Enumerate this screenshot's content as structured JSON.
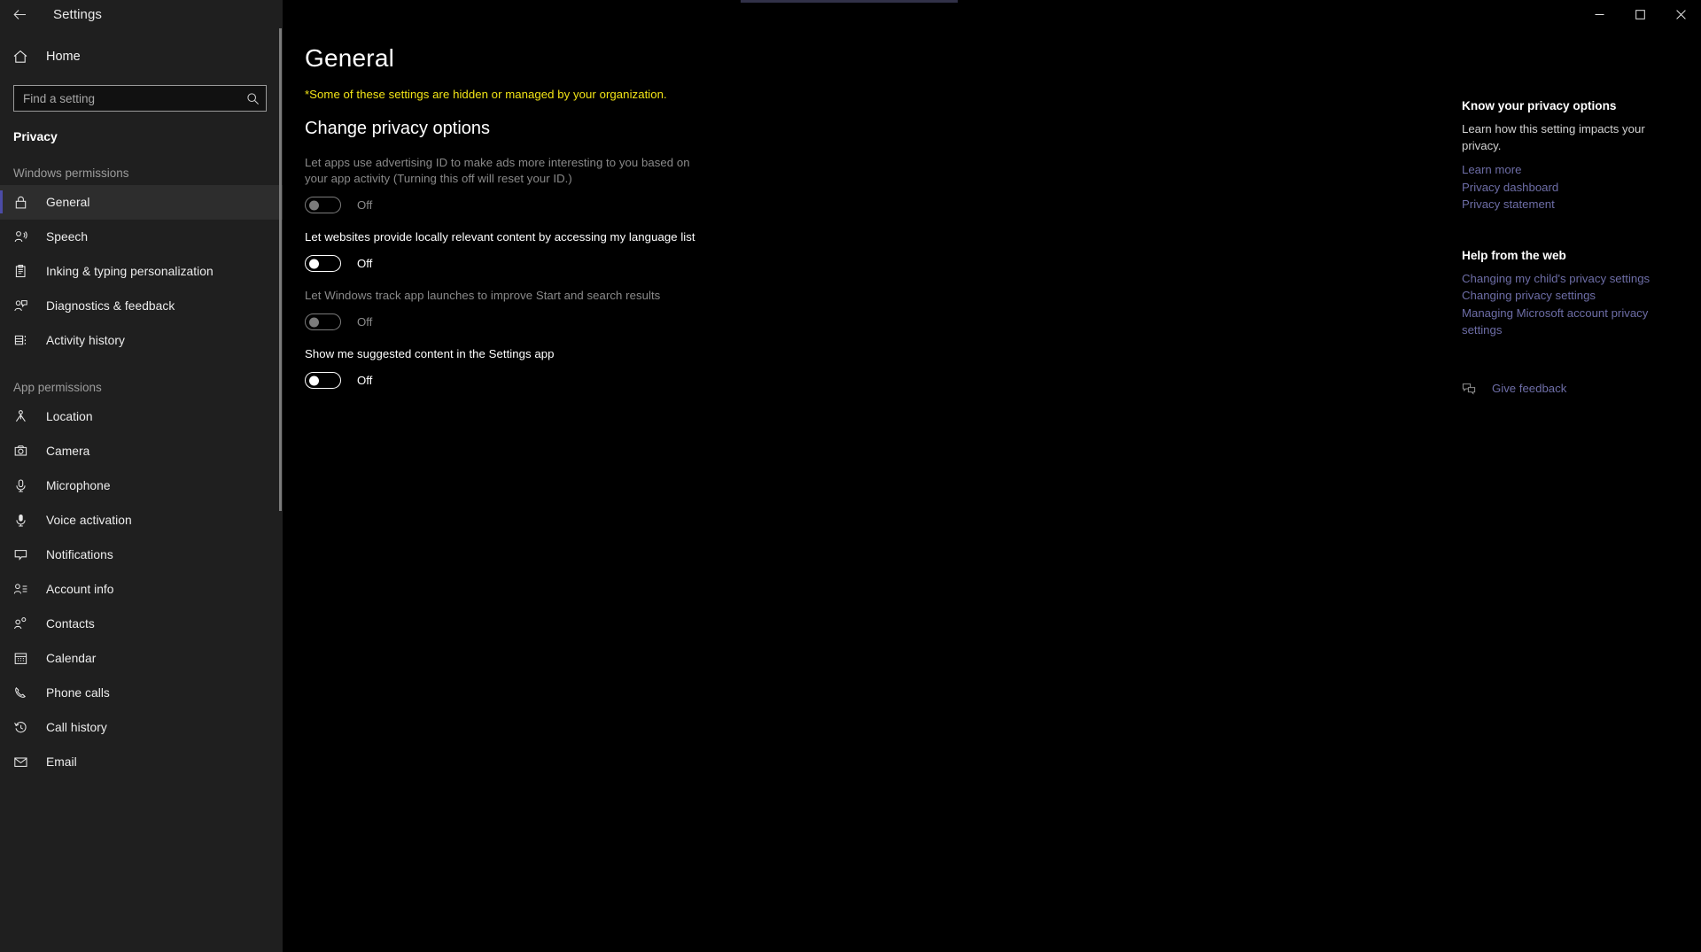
{
  "window": {
    "title": "Settings",
    "back_icon": "back-arrow-icon",
    "minimize_label": "─",
    "maximize_label": "☐",
    "close_label": "✕"
  },
  "sidebar": {
    "home_label": "Home",
    "home_icon": "home-icon",
    "search": {
      "placeholder": "Find a setting",
      "value": "",
      "icon": "search-icon"
    },
    "category_title": "Privacy",
    "groups": [
      {
        "label": "Windows permissions",
        "items": [
          {
            "label": "General",
            "icon": "lock-icon",
            "selected": true
          },
          {
            "label": "Speech",
            "icon": "speech-person-icon",
            "selected": false
          },
          {
            "label": "Inking & typing personalization",
            "icon": "clipboard-pen-icon",
            "selected": false
          },
          {
            "label": "Diagnostics & feedback",
            "icon": "person-feedback-icon",
            "selected": false
          },
          {
            "label": "Activity history",
            "icon": "activity-history-icon",
            "selected": false
          }
        ]
      },
      {
        "label": "App permissions",
        "items": [
          {
            "label": "Location",
            "icon": "location-pin-icon",
            "selected": false
          },
          {
            "label": "Camera",
            "icon": "camera-icon",
            "selected": false
          },
          {
            "label": "Microphone",
            "icon": "microphone-icon",
            "selected": false
          },
          {
            "label": "Voice activation",
            "icon": "voice-activation-icon",
            "selected": false
          },
          {
            "label": "Notifications",
            "icon": "notification-bubble-icon",
            "selected": false
          },
          {
            "label": "Account info",
            "icon": "account-info-icon",
            "selected": false
          },
          {
            "label": "Contacts",
            "icon": "contacts-icon",
            "selected": false
          },
          {
            "label": "Calendar",
            "icon": "calendar-icon",
            "selected": false
          },
          {
            "label": "Phone calls",
            "icon": "phone-icon",
            "selected": false
          },
          {
            "label": "Call history",
            "icon": "call-history-icon",
            "selected": false
          },
          {
            "label": "Email",
            "icon": "email-icon",
            "selected": false
          }
        ]
      }
    ]
  },
  "main": {
    "page_title": "General",
    "org_note": "*Some of these settings are hidden or managed by your organization.",
    "section_title": "Change privacy options",
    "settings": [
      {
        "label": "Let apps use advertising ID to make ads more interesting to you based on your app activity (Turning this off will reset your ID.)",
        "state": "Off",
        "managed": true
      },
      {
        "label": "Let websites provide locally relevant content by accessing my language list",
        "state": "Off",
        "managed": false
      },
      {
        "label": "Let Windows track app launches to improve Start and search results",
        "state": "Off",
        "managed": true
      },
      {
        "label": "Show me suggested content in the Settings app",
        "state": "Off",
        "managed": false
      }
    ]
  },
  "rail": {
    "privacy_block": {
      "heading": "Know your privacy options",
      "body": "Learn how this setting impacts your privacy.",
      "links": [
        "Learn more",
        "Privacy dashboard",
        "Privacy statement"
      ]
    },
    "help_block": {
      "heading": "Help from the web",
      "links": [
        "Changing my child's privacy settings",
        "Changing privacy settings",
        "Managing Microsoft account privacy settings"
      ]
    },
    "feedback": {
      "label": "Give feedback",
      "icon": "feedback-icon"
    }
  },
  "colors": {
    "accent_link": "#6d6da6",
    "warning": "#f2e416",
    "sidebar_bg": "#1f1f1f",
    "content_bg": "#000000",
    "selection_bar": "#4c4ca6"
  }
}
